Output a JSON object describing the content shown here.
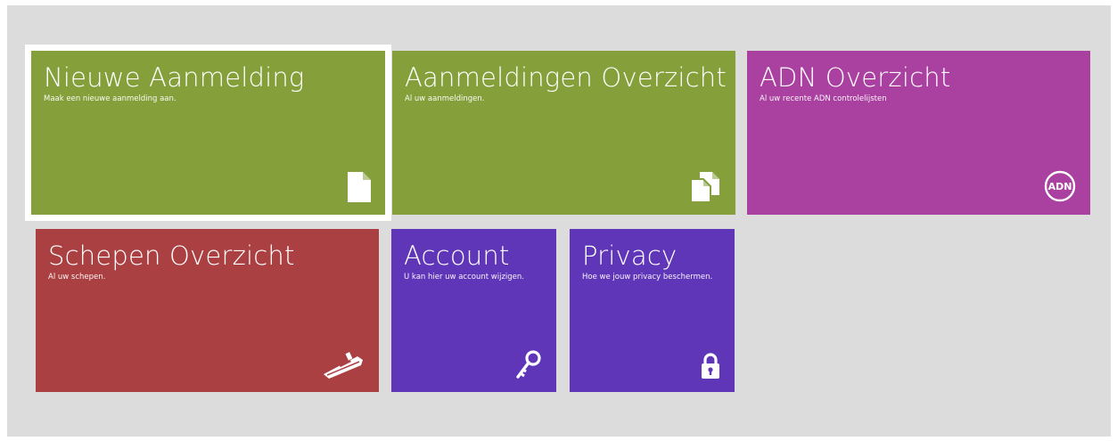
{
  "colors": {
    "background": "#dcdcdc",
    "green": "#85a03a",
    "magenta": "#aa40a0",
    "red": "#ab4042",
    "purple": "#6036b9",
    "selection_outline": "#ffffff"
  },
  "tiles": [
    {
      "title": "Nieuwe Aanmelding",
      "subtitle": "Maak een nieuwe aanmelding aan.",
      "icon": "document-icon",
      "color": "green",
      "selected": true
    },
    {
      "title": "Aanmeldingen Overzicht",
      "subtitle": "Al uw aanmeldingen.",
      "icon": "documents-icon",
      "color": "green"
    },
    {
      "title": "ADN Overzicht",
      "subtitle": "Al uw recente ADN controlelijsten",
      "icon": "adn-badge-icon",
      "icon_text": "ADN",
      "color": "magenta"
    },
    {
      "title": "Schepen Overzicht",
      "subtitle": "Al uw schepen.",
      "icon": "ship-icon",
      "color": "red"
    },
    {
      "title": "Account",
      "subtitle": "U kan hier uw account wijzigen.",
      "icon": "key-icon",
      "color": "purple"
    },
    {
      "title": "Privacy",
      "subtitle": "Hoe we jouw privacy beschermen.",
      "icon": "lock-icon",
      "color": "purple"
    }
  ]
}
